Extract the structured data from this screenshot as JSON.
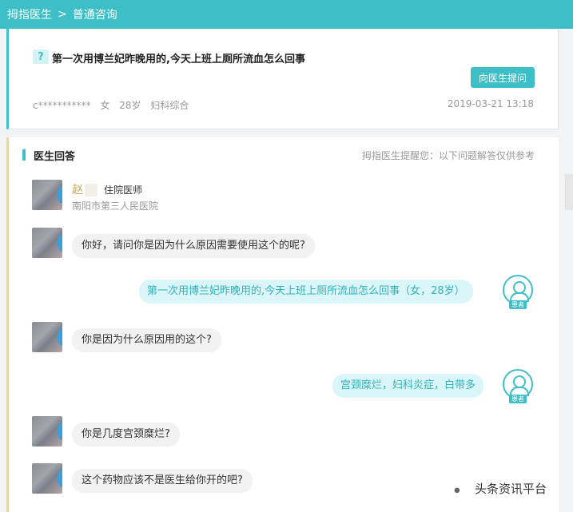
{
  "breadcrumb": {
    "home": "拇指医生",
    "separator": ">",
    "current": "普通咨询"
  },
  "question": {
    "mark": "?",
    "title": "第一次用博兰妃昨晚用的,今天上班上厕所流血怎么回事",
    "ask_button": "向医生提问",
    "user": "c***********",
    "gender": "女",
    "age": "28岁",
    "department": "妇科综合",
    "date": "2019-03-21 13:18"
  },
  "answer": {
    "heading": "医生回答",
    "notice": "拇指医生提醒您：以下问题解答仅供参考",
    "doctor": {
      "name": "赵",
      "title": "住院医师",
      "hospital": "南阳市第三人民医院"
    },
    "patient_tag": "患者",
    "messages": [
      {
        "from": "doctor",
        "text": "你好，请问你是因为什么原因需要使用这个的呢?"
      },
      {
        "from": "patient",
        "text": "第一次用博兰妃昨晚用的,今天上班上厕所流血怎么回事（女，28岁）"
      },
      {
        "from": "doctor",
        "text": "你是因为什么原因用的这个?"
      },
      {
        "from": "patient",
        "text": "宫颈糜烂，妇科炎症，白带多"
      },
      {
        "from": "doctor",
        "text": "你是几度宫颈糜烂?"
      },
      {
        "from": "doctor",
        "text": "这个药物应该不是医生给你开的吧?"
      }
    ]
  },
  "watermark": {
    "icon": "wechat-icon",
    "text": "头条资讯平台"
  },
  "colors": {
    "accent": "#3ebfc7",
    "patient_bubble": "#daf6f8",
    "doctor_bubble": "#f2f2f2",
    "doctor_name": "#c9a85a"
  }
}
